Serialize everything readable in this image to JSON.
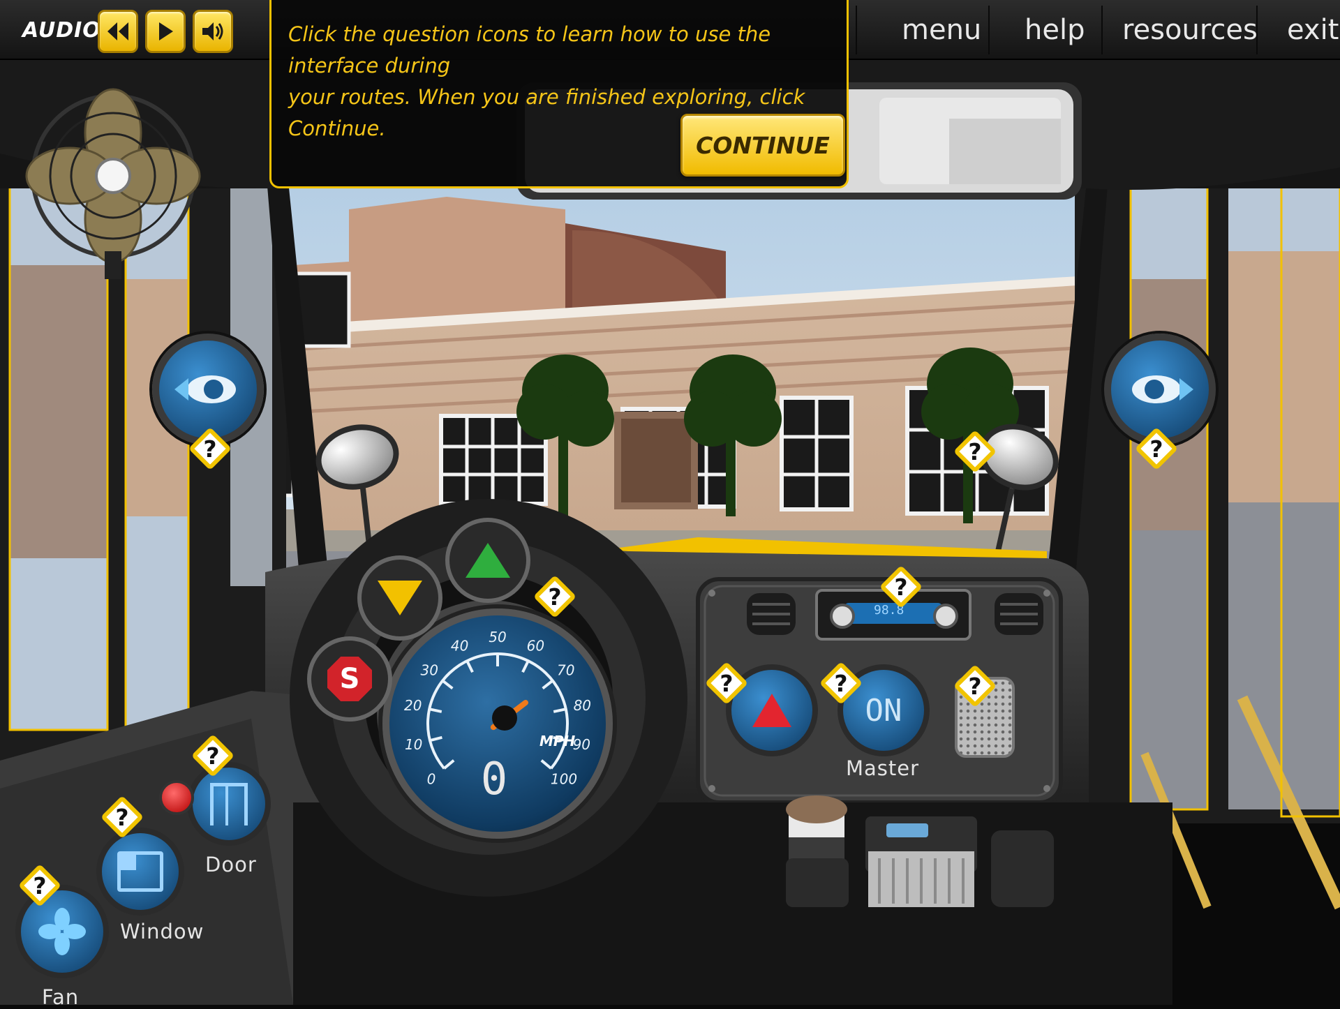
{
  "topbar": {
    "audio_label": "AUDIO",
    "nav": [
      "menu",
      "help",
      "resources",
      "exit"
    ]
  },
  "tooltip": {
    "line1": "Click the question icons to learn how to use the interface during",
    "line2": "your routes. When you are finished exploring, click Continue.",
    "continue_label": "CONTINUE"
  },
  "dashboard": {
    "speed_value": "0",
    "speed_unit": "MPH",
    "speed_ticks": [
      "0",
      "10",
      "20",
      "30",
      "40",
      "50",
      "60",
      "70",
      "80",
      "90",
      "100"
    ],
    "stop_sign_letter": "S",
    "master_button": "ON",
    "master_label": "Master",
    "radio_display": "98.8"
  },
  "controls": {
    "door_label": "Door",
    "window_label": "Window",
    "fan_label": "Fan"
  },
  "help_mark": "?",
  "colors": {
    "accent_yellow": "#f2c100",
    "tooltip_text": "#f5c518",
    "sky": "#c3d9ec",
    "needle": "#f07a1a"
  },
  "icons": [
    "rewind-icon",
    "play-icon",
    "volume-icon",
    "eye-left-icon",
    "eye-right-icon",
    "hazard-icon",
    "door-icon",
    "window-icon",
    "fan-icon",
    "stop-sign-icon"
  ]
}
